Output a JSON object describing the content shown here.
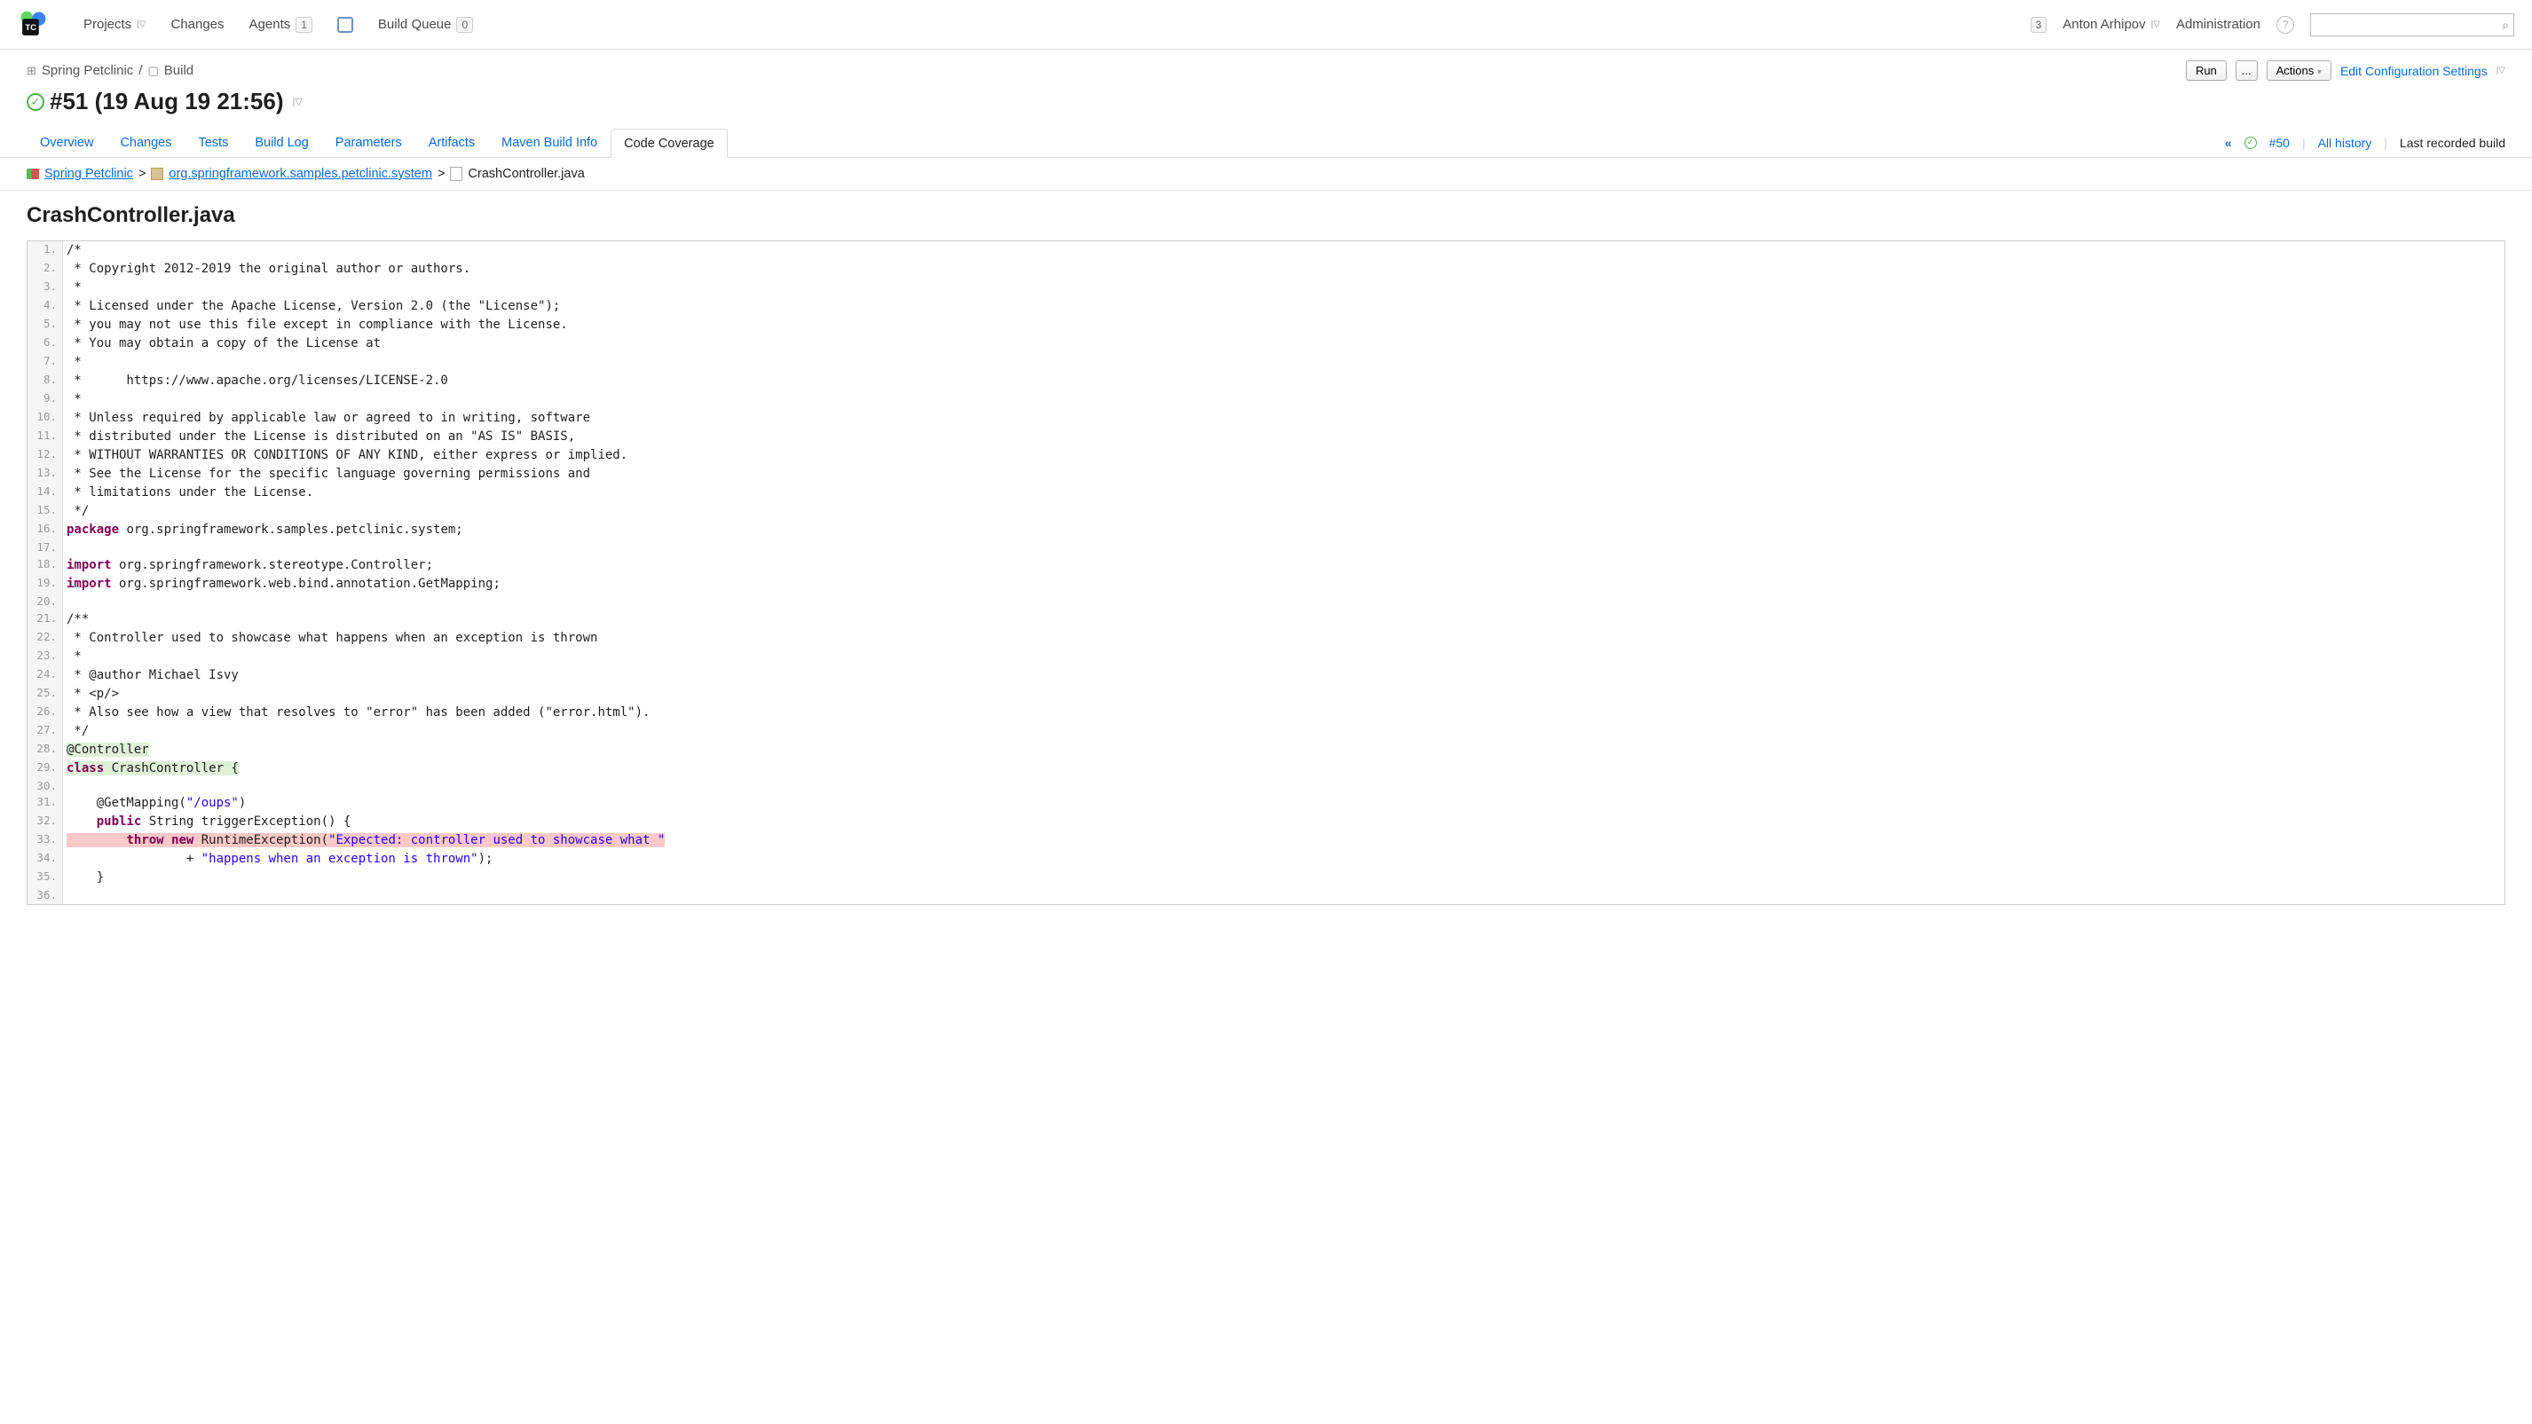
{
  "topnav": {
    "projects": "Projects",
    "changes": "Changes",
    "agents": "Agents",
    "agents_count": "1",
    "build_queue": "Build Queue",
    "build_queue_count": "0"
  },
  "rightnav": {
    "notif_count": "3",
    "user": "Anton Arhipov",
    "admin": "Administration"
  },
  "breadcrumb": {
    "project": "Spring Petclinic",
    "build": "Build"
  },
  "actions": {
    "run": "Run",
    "more": "...",
    "actions": "Actions",
    "edit": "Edit Configuration Settings"
  },
  "title": "#51 (19 Aug 19 21:56)",
  "tabs": {
    "overview": "Overview",
    "changes": "Changes",
    "tests": "Tests",
    "buildlog": "Build Log",
    "parameters": "Parameters",
    "artifacts": "Artifacts",
    "maven": "Maven Build Info",
    "coverage": "Code Coverage"
  },
  "tabright": {
    "prev": "«",
    "prev_build": "#50",
    "all_history": "All history",
    "last_recorded": "Last recorded build"
  },
  "path": {
    "root": "Spring Petclinic",
    "pkg": "org.springframework.samples.petclinic.system",
    "file": "CrashController.java"
  },
  "file_title": "CrashController.java",
  "code": [
    {
      "n": "1.",
      "segs": [
        {
          "t": "/*",
          "c": "c-comment"
        }
      ]
    },
    {
      "n": "2.",
      "segs": [
        {
          "t": " * Copyright 2012-2019 the original author or authors.",
          "c": "c-comment"
        }
      ]
    },
    {
      "n": "3.",
      "segs": [
        {
          "t": " *",
          "c": "c-comment"
        }
      ]
    },
    {
      "n": "4.",
      "segs": [
        {
          "t": " * Licensed under the Apache License, Version 2.0 (the \"License\");",
          "c": "c-comment"
        }
      ]
    },
    {
      "n": "5.",
      "segs": [
        {
          "t": " * you may not use this file except in compliance with the License.",
          "c": "c-comment"
        }
      ]
    },
    {
      "n": "6.",
      "segs": [
        {
          "t": " * You may obtain a copy of the License at",
          "c": "c-comment"
        }
      ]
    },
    {
      "n": "7.",
      "segs": [
        {
          "t": " *",
          "c": "c-comment"
        }
      ]
    },
    {
      "n": "8.",
      "segs": [
        {
          "t": " *      https://www.apache.org/licenses/LICENSE-2.0",
          "c": "c-comment"
        }
      ]
    },
    {
      "n": "9.",
      "segs": [
        {
          "t": " *",
          "c": "c-comment"
        }
      ]
    },
    {
      "n": "10.",
      "segs": [
        {
          "t": " * Unless required by applicable law or agreed to in writing, software",
          "c": "c-comment"
        }
      ]
    },
    {
      "n": "11.",
      "segs": [
        {
          "t": " * distributed under the License is distributed on an \"AS IS\" BASIS,",
          "c": "c-comment"
        }
      ]
    },
    {
      "n": "12.",
      "segs": [
        {
          "t": " * WITHOUT WARRANTIES OR CONDITIONS OF ANY KIND, either express or implied.",
          "c": "c-comment"
        }
      ]
    },
    {
      "n": "13.",
      "segs": [
        {
          "t": " * See the License for the specific language governing permissions and",
          "c": "c-comment"
        }
      ]
    },
    {
      "n": "14.",
      "segs": [
        {
          "t": " * limitations under the License.",
          "c": "c-comment"
        }
      ]
    },
    {
      "n": "15.",
      "segs": [
        {
          "t": " */",
          "c": "c-comment"
        }
      ]
    },
    {
      "n": "16.",
      "segs": [
        {
          "t": "package",
          "c": "c-key"
        },
        {
          "t": " org.springframework.samples.petclinic.system;"
        }
      ]
    },
    {
      "n": "17.",
      "segs": [
        {
          "t": ""
        }
      ]
    },
    {
      "n": "18.",
      "segs": [
        {
          "t": "import",
          "c": "c-key"
        },
        {
          "t": " org.springframework.stereotype.Controller;"
        }
      ]
    },
    {
      "n": "19.",
      "segs": [
        {
          "t": "import",
          "c": "c-key"
        },
        {
          "t": " org.springframework.web.bind.annotation.GetMapping;"
        }
      ]
    },
    {
      "n": "20.",
      "segs": [
        {
          "t": ""
        }
      ]
    },
    {
      "n": "21.",
      "segs": [
        {
          "t": "/**",
          "c": "c-comment"
        }
      ]
    },
    {
      "n": "22.",
      "segs": [
        {
          "t": " * Controller used to showcase what happens when an exception is thrown",
          "c": "c-comment"
        }
      ]
    },
    {
      "n": "23.",
      "segs": [
        {
          "t": " *",
          "c": "c-comment"
        }
      ]
    },
    {
      "n": "24.",
      "segs": [
        {
          "t": " * @author Michael Isvy",
          "c": "c-comment"
        }
      ]
    },
    {
      "n": "25.",
      "segs": [
        {
          "t": " * <p/>",
          "c": "c-comment"
        }
      ]
    },
    {
      "n": "26.",
      "segs": [
        {
          "t": " * Also see how a view that resolves to \"error\" has been added (\"error.html\").",
          "c": "c-comment"
        }
      ]
    },
    {
      "n": "27.",
      "segs": [
        {
          "t": " */",
          "c": "c-comment"
        }
      ]
    },
    {
      "n": "28.",
      "hl": "hl-green",
      "segs": [
        {
          "t": "@Controller",
          "c": "c-ann"
        }
      ]
    },
    {
      "n": "29.",
      "hl": "hl-green",
      "segs": [
        {
          "t": "class",
          "c": "c-key"
        },
        {
          "t": " CrashController {"
        }
      ]
    },
    {
      "n": "30.",
      "segs": [
        {
          "t": ""
        }
      ]
    },
    {
      "n": "31.",
      "segs": [
        {
          "t": "    @GetMapping("
        },
        {
          "t": "\"/oups\"",
          "c": "c-str"
        },
        {
          "t": ")"
        }
      ]
    },
    {
      "n": "32.",
      "segs": [
        {
          "t": "    "
        },
        {
          "t": "public",
          "c": "c-key"
        },
        {
          "t": " String triggerException() {"
        }
      ]
    },
    {
      "n": "33.",
      "hl": "hl-red",
      "segs": [
        {
          "t": "        "
        },
        {
          "t": "throw new",
          "c": "c-key"
        },
        {
          "t": " RuntimeException("
        },
        {
          "t": "\"Expected: controller used to showcase what \"",
          "c": "c-str"
        }
      ]
    },
    {
      "n": "34.",
      "segs": [
        {
          "t": "                + "
        },
        {
          "t": "\"happens when an exception is thrown\"",
          "c": "c-str"
        },
        {
          "t": ");"
        }
      ]
    },
    {
      "n": "35.",
      "segs": [
        {
          "t": "    }"
        }
      ]
    },
    {
      "n": "36.",
      "segs": [
        {
          "t": ""
        }
      ]
    }
  ]
}
